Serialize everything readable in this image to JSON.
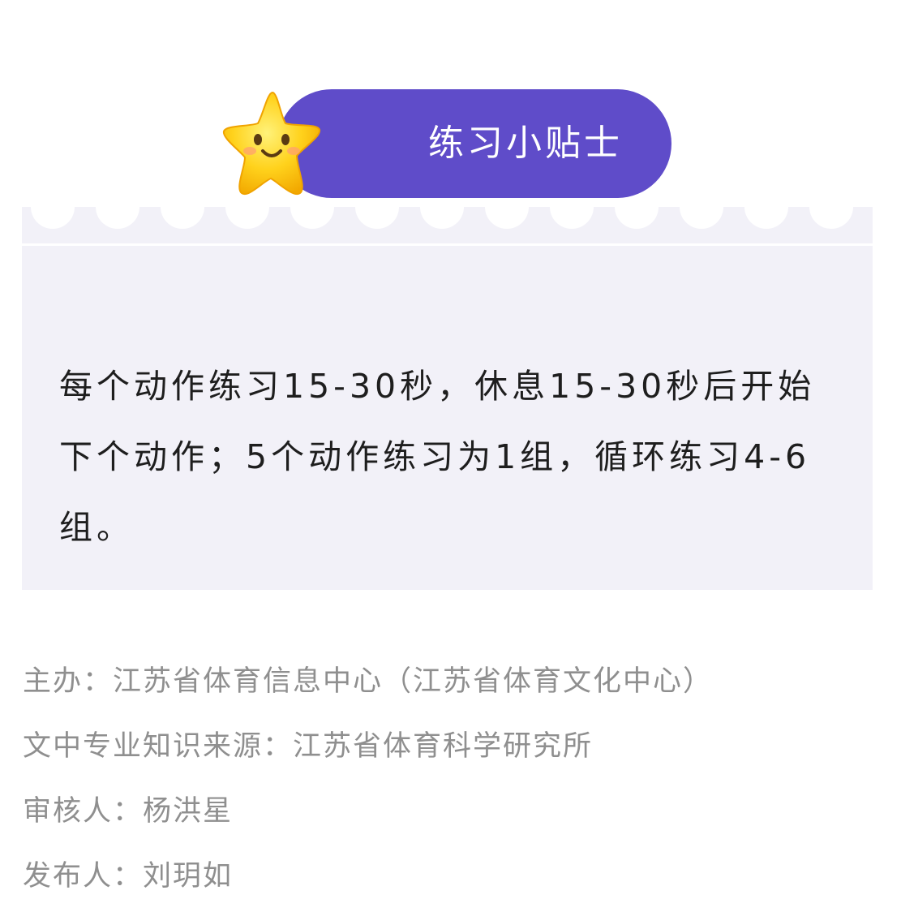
{
  "tip": {
    "title": "练习小贴士",
    "body": "每个动作练习15-30秒，休息15-30秒后开始下个动作；5个动作练习为1组，循环练习4-6组。"
  },
  "credits": [
    "主办：江苏省体育信息中心（江苏省体育文化中心）",
    "文中专业知识来源：江苏省体育科学研究所",
    "审核人：杨洪星",
    "发布人：刘玥如"
  ],
  "colors": {
    "pill": "#5f4cc9",
    "card_bg": "#f2f1f8",
    "star_fill": "#ffd51f",
    "credit_text": "#8f8f8f",
    "body_text": "#1e1e1e"
  },
  "icons": {
    "star": "smiling-star-icon",
    "dot": "dot-icon"
  }
}
